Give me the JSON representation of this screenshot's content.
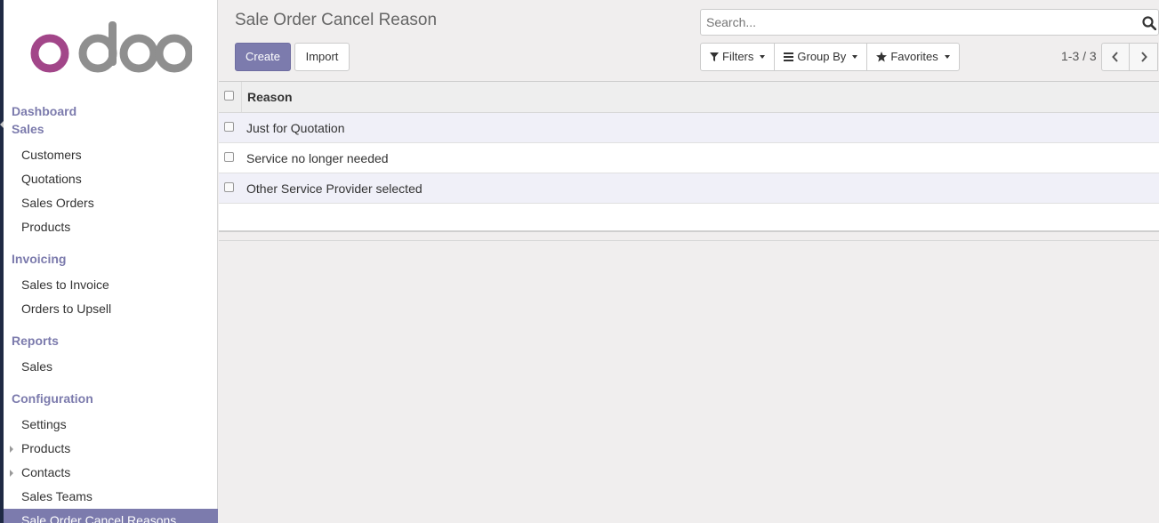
{
  "logo": {
    "text": "odoo",
    "color_o1": "#a24689",
    "color_rest": "#8f8f8f"
  },
  "sidebar": {
    "sections": [
      {
        "label": "Dashboard"
      },
      {
        "label": "Sales",
        "items": [
          "Customers",
          "Quotations",
          "Sales Orders",
          "Products"
        ]
      },
      {
        "label": "Invoicing",
        "items": [
          "Sales to Invoice",
          "Orders to Upsell"
        ]
      },
      {
        "label": "Reports",
        "items": [
          "Sales"
        ]
      },
      {
        "label": "Configuration",
        "items": [
          "Settings",
          "Products",
          "Contacts",
          "Sales Teams",
          "Sale Order Cancel Reasons"
        ]
      }
    ],
    "active_item": "Sale Order Cancel Reasons",
    "accent_color": "#7c7bad"
  },
  "header": {
    "title": "Sale Order Cancel Reason",
    "create_label": "Create",
    "import_label": "Import",
    "search_placeholder": "Search...",
    "filters_label": "Filters",
    "groupby_label": "Group By",
    "favorites_label": "Favorites",
    "pager": "1-3 / 3"
  },
  "table": {
    "column_header": "Reason",
    "rows": [
      "Just for Quotation",
      "Service no longer needed",
      "Other Service Provider selected"
    ]
  }
}
